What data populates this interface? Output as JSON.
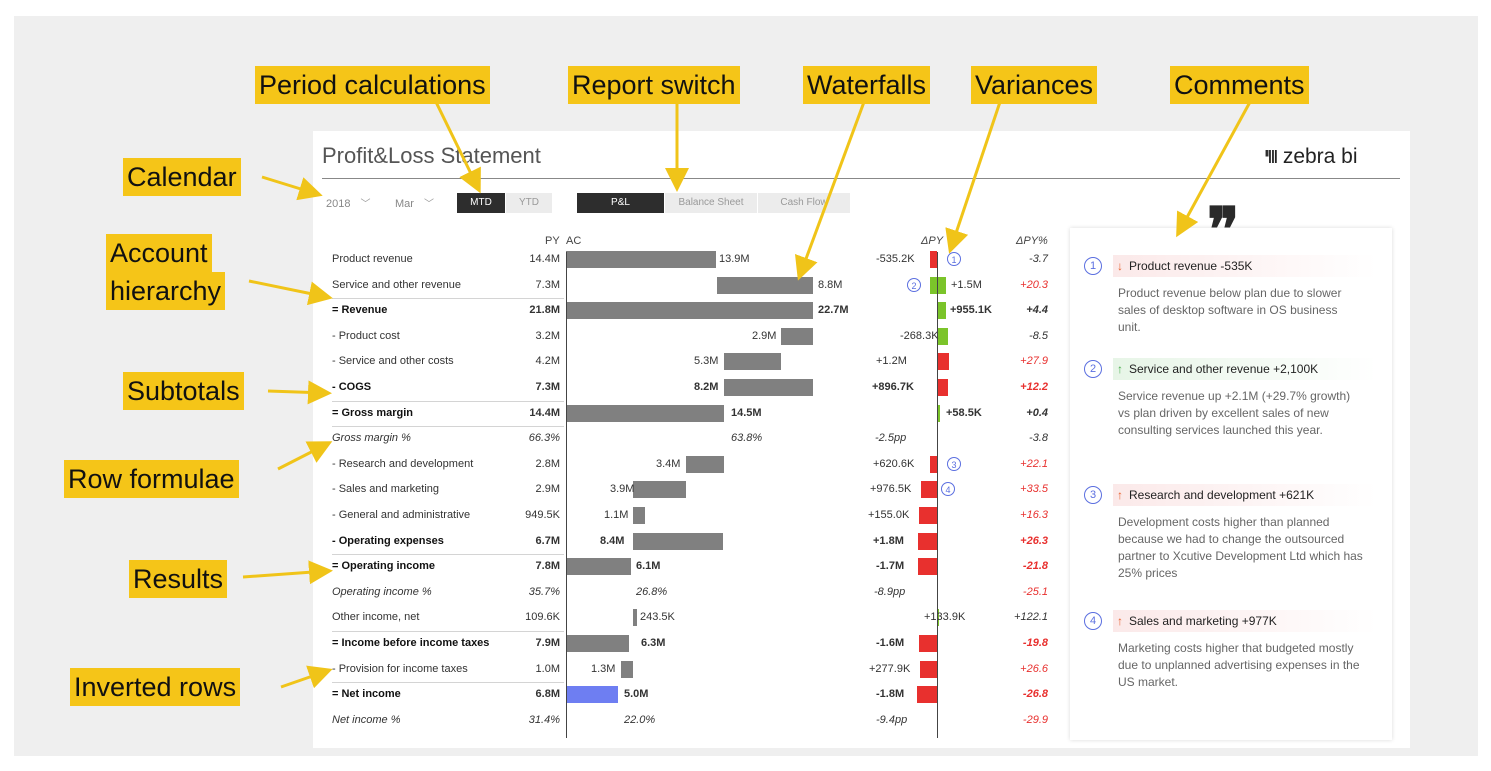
{
  "report": {
    "title": "Profit&Loss Statement",
    "brand": "zebra bi",
    "brand_mark": "ᴵᴵ|||",
    "year": "2018",
    "month": "Mar",
    "period_buttons": [
      "MTD",
      "YTD"
    ],
    "report_buttons": [
      "P&L",
      "Balance Sheet",
      "Cash Flow"
    ],
    "columns": {
      "py": "PY",
      "ac": "AC",
      "dpy": "ΔPY",
      "dpy_pct": "ΔPY%"
    }
  },
  "rows": [
    {
      "label": "Product revenue",
      "py": "14.4M",
      "ac": "13.9M",
      "dpy": "-535.2K",
      "dpct": "-3.7"
    },
    {
      "label": "Service and other revenue",
      "py": "7.3M",
      "ac": "8.8M",
      "dpy": "+1.5M",
      "dpct": "+20.3"
    },
    {
      "label": "= Revenue",
      "py": "21.8M",
      "ac": "22.7M",
      "dpy": "+955.1K",
      "dpct": "+4.4"
    },
    {
      "label": "- Product cost",
      "py": "3.2M",
      "ac": "2.9M",
      "dpy": "-268.3K",
      "dpct": "-8.5"
    },
    {
      "label": "- Service and other costs",
      "py": "4.2M",
      "ac": "5.3M",
      "dpy": "+1.2M",
      "dpct": "+27.9"
    },
    {
      "label": "- COGS",
      "py": "7.3M",
      "ac": "8.2M",
      "dpy": "+896.7K",
      "dpct": "+12.2"
    },
    {
      "label": "= Gross margin",
      "py": "14.4M",
      "ac": "14.5M",
      "dpy": "+58.5K",
      "dpct": "+0.4"
    },
    {
      "label": "Gross margin %",
      "py": "66.3%",
      "ac": "63.8%",
      "dpy": "-2.5pp",
      "dpct": "-3.8"
    },
    {
      "label": "- Research and development",
      "py": "2.8M",
      "ac": "3.4M",
      "dpy": "+620.6K",
      "dpct": "+22.1"
    },
    {
      "label": "- Sales and marketing",
      "py": "2.9M",
      "ac": "3.9M",
      "dpy": "+976.5K",
      "dpct": "+33.5"
    },
    {
      "label": "- General and administrative",
      "py": "949.5K",
      "ac": "1.1M",
      "dpy": "+155.0K",
      "dpct": "+16.3"
    },
    {
      "label": "- Operating expenses",
      "py": "6.7M",
      "ac": "8.4M",
      "dpy": "+1.8M",
      "dpct": "+26.3"
    },
    {
      "label": "= Operating income",
      "py": "7.8M",
      "ac": "6.1M",
      "dpy": "-1.7M",
      "dpct": "-21.8"
    },
    {
      "label": "Operating income %",
      "py": "35.7%",
      "ac": "26.8%",
      "dpy": "-8.9pp",
      "dpct": "-25.1"
    },
    {
      "label": "Other income, net",
      "py": "109.6K",
      "ac": "243.5K",
      "dpy": "+133.9K",
      "dpct": "+122.1"
    },
    {
      "label": "= Income before income taxes",
      "py": "7.9M",
      "ac": "6.3M",
      "dpy": "-1.6M",
      "dpct": "-19.8"
    },
    {
      "label": "- Provision for income taxes",
      "py": "1.0M",
      "ac": "1.3M",
      "dpy": "+277.9K",
      "dpct": "+26.6"
    },
    {
      "label": "= Net income",
      "py": "6.8M",
      "ac": "5.0M",
      "dpy": "-1.8M",
      "dpct": "-26.8"
    },
    {
      "label": "Net income %",
      "py": "31.4%",
      "ac": "22.0%",
      "dpy": "-9.4pp",
      "dpct": "-29.9"
    }
  ],
  "markers": [
    "1",
    "2",
    "3",
    "4"
  ],
  "comments": [
    {
      "num": "1",
      "title": "Product revenue",
      "value": "-535K",
      "text": "Product revenue below plan due to slower sales of desktop software in OS business unit."
    },
    {
      "num": "2",
      "title": "Service and other revenue",
      "value": "+2,100K",
      "text": "Service revenue up +2.1M (+29.7% growth) vs plan driven by excellent sales of new consulting services launched this year."
    },
    {
      "num": "3",
      "title": "Research and development",
      "value": "+621K",
      "text": "Development costs higher than planned because we had to change the outsourced partner to Xcutive Development Ltd which has 25% prices"
    },
    {
      "num": "4",
      "title": "Sales and marketing",
      "value": "+977K",
      "text": "Marketing costs higher that budgeted mostly due to unplanned advertising expenses in the US market."
    }
  ],
  "callouts": {
    "period": "Period calculations",
    "report_switch": "Report switch",
    "waterfalls": "Waterfalls",
    "variances": "Variances",
    "comments": "Comments",
    "calendar": "Calendar",
    "account": "Account",
    "hierarchy": "hierarchy",
    "subtotals": "Subtotals",
    "row_formulae": "Row formulae",
    "results": "Results",
    "inverted": "Inverted rows"
  },
  "colors": {
    "accent_red": "#e8302e",
    "accent_green": "#7bc42a",
    "net_income_bar": "#6e7ef2",
    "callout": "#f5c518"
  }
}
